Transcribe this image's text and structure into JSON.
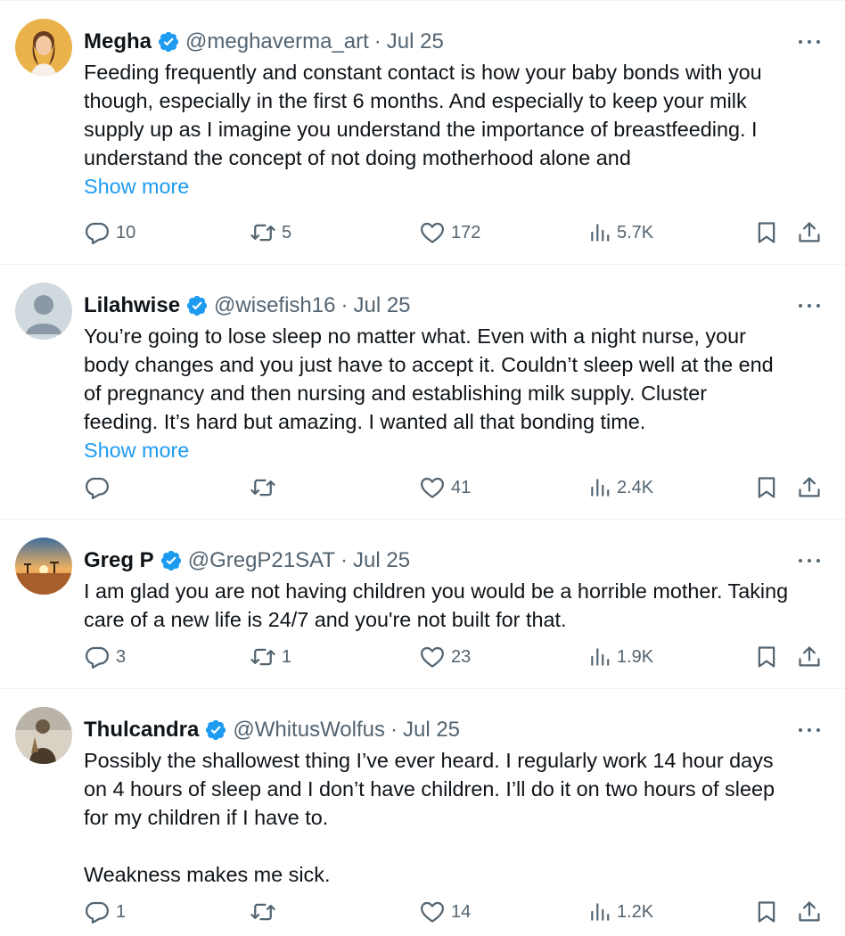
{
  "tweets": [
    {
      "name": "Megha",
      "handle": "@meghaverma_art",
      "separator": "·",
      "date": "Jul 25",
      "lines": [
        "Feeding frequently and constant contact is how your baby bonds with you",
        "though, especially in the first 6 months. And especially to keep your milk",
        "supply up as I imagine you understand the importance of breastfeeding. I",
        "understand the concept of not doing motherhood alone and"
      ],
      "show_more": "Show more",
      "replies": "10",
      "retweets": "5",
      "likes": "172",
      "views": "5.7K",
      "avatar_icon": "photo-avatar"
    },
    {
      "name": "Lilahwise",
      "handle": "@wisefish16",
      "separator": "·",
      "date": "Jul 25",
      "lines": [
        "You’re going to lose sleep no matter what. Even with a night nurse, your",
        "body changes and you just have to accept it. Couldn’t sleep well at the end",
        "of pregnancy and then nursing and establishing milk supply. Cluster",
        "feeding. It’s hard but amazing. I wanted all that bonding time."
      ],
      "show_more": "Show more",
      "replies": "",
      "retweets": "",
      "likes": "41",
      "views": "2.4K",
      "avatar_icon": "default-avatar"
    },
    {
      "name": "Greg P",
      "handle": "@GregP21SAT",
      "separator": "·",
      "date": "Jul 25",
      "lines": [
        "I am glad you are not having children you would be a horrible mother. Taking",
        "care of a new life is 24/7 and you're not built for that."
      ],
      "show_more": "",
      "replies": "3",
      "retweets": "1",
      "likes": "23",
      "views": "1.9K",
      "avatar_icon": "landscape-avatar"
    },
    {
      "name": "Thulcandra",
      "handle": "@WhitusWolfus",
      "separator": "·",
      "date": "Jul 25",
      "lines": [
        "Possibly the shallowest thing I’ve ever heard. I regularly work 14 hour days",
        "on 4 hours of sleep and I don’t have children. I’ll do it on two hours of sleep",
        "for my children if I have to.",
        "",
        "Weakness makes me sick."
      ],
      "show_more": "",
      "replies": "1",
      "retweets": "",
      "likes": "14",
      "views": "1.2K",
      "avatar_icon": "portrait-avatar"
    }
  ],
  "colors": {
    "text": "#0f1419",
    "secondary": "#536471",
    "link": "#1d9bf0",
    "verified": "#1d9bf0",
    "border": "#eff3f4"
  },
  "icons": {
    "reply": "reply-icon",
    "retweet": "retweet-icon",
    "like": "heart-icon",
    "views": "views-icon",
    "bookmark": "bookmark-icon",
    "share": "share-icon",
    "more": "more-icon",
    "verified": "verified-badge-icon"
  }
}
